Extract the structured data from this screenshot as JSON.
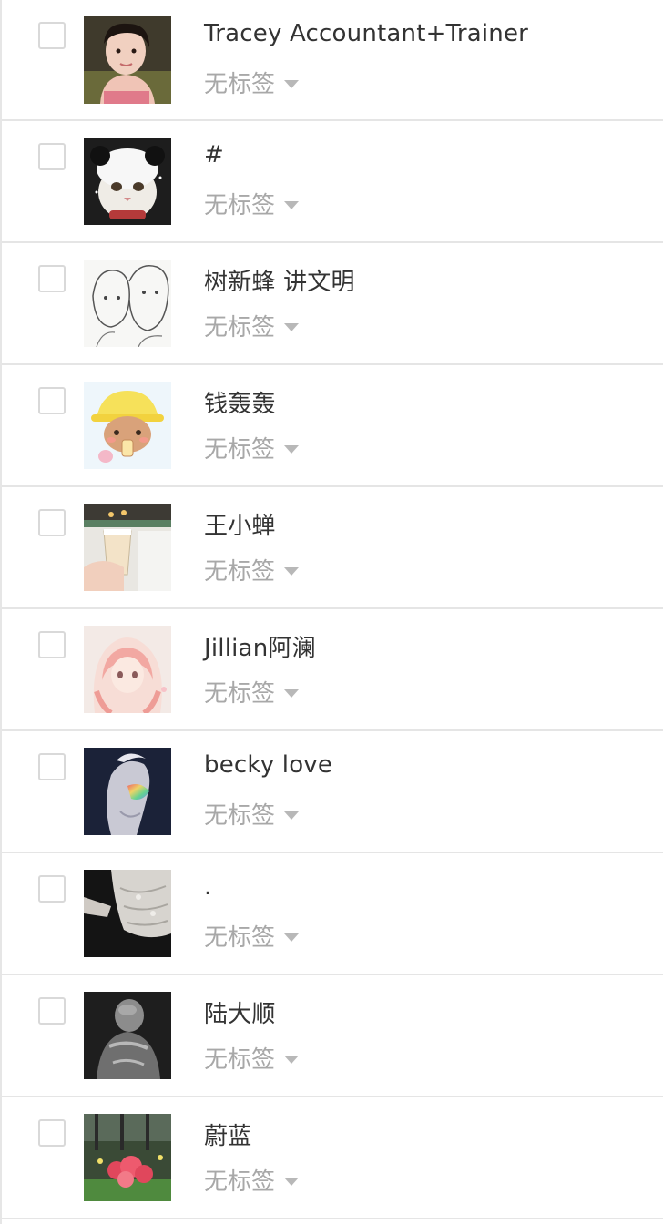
{
  "contacts": [
    {
      "name": "Tracey Accountant+Trainer",
      "tag": "无标签",
      "avatar": "avatar-photo-girl"
    },
    {
      "name": "#",
      "tag": "无标签",
      "avatar": "avatar-cat-panda-hat"
    },
    {
      "name": "树新蜂 讲文明",
      "tag": "无标签",
      "avatar": "avatar-sketch-couple"
    },
    {
      "name": "钱轰轰",
      "tag": "无标签",
      "avatar": "avatar-cartoon-bear"
    },
    {
      "name": "王小蝉",
      "tag": "无标签",
      "avatar": "avatar-drink-cup"
    },
    {
      "name": "Jillian阿澜",
      "tag": "无标签",
      "avatar": "avatar-anime-girl"
    },
    {
      "name": "becky love",
      "tag": "无标签",
      "avatar": "avatar-portrait-rainbow"
    },
    {
      "name": ".",
      "tag": "无标签",
      "avatar": "avatar-lace-sleeve"
    },
    {
      "name": "陆大顺",
      "tag": "无标签",
      "avatar": "avatar-bw-figure"
    },
    {
      "name": "蔚蓝",
      "tag": "无标签",
      "avatar": "avatar-flowers"
    }
  ],
  "colors": {
    "name_text": "#333333",
    "tag_text": "#a8a8a8",
    "divider": "#e5e5e5",
    "checkbox_border": "#d9d9d9"
  }
}
